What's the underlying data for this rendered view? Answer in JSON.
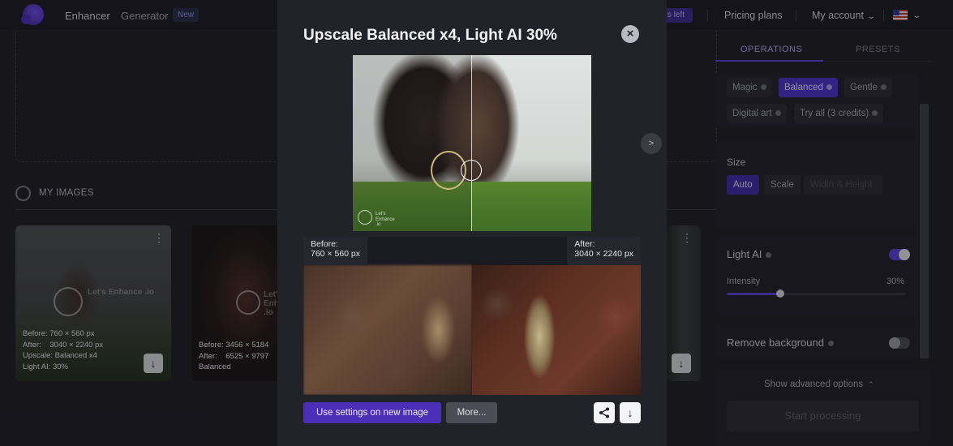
{
  "nav": {
    "enhancer": "Enhancer",
    "generator": "Generator",
    "new_badge": "New",
    "credits_left": "s left",
    "pricing": "Pricing plans",
    "account": "My account"
  },
  "gallery": {
    "section_label": "MY IMAGES",
    "thumb1": {
      "info": "Before: 760 × 560 px\nAfter:    3040 × 2240 px\nUpscale: Balanced x4\nLight AI: 30%",
      "watermark": "Let's\nEnhance\n.io"
    },
    "thumb2": {
      "info": "Before: 3456 × 5184\nAfter:    6525 × 9797\nBalanced",
      "watermark": "Let's\nEnhance\n.io"
    }
  },
  "panel": {
    "tab_operations": "OPERATIONS",
    "tab_presets": "PRESETS",
    "modes": [
      "Magic",
      "Balanced",
      "Gentle",
      "Digital art",
      "Try all (3 credits)"
    ],
    "active_mode": "Balanced",
    "size_label": "Size",
    "size_options": [
      "Auto",
      "Scale",
      "Width & Height"
    ],
    "active_size": "Auto",
    "light_ai_label": "Light AI",
    "light_ai_on": true,
    "intensity_label": "Intensity",
    "intensity_value": "30%",
    "intensity_fraction": 0.3,
    "remove_bg_label": "Remove background",
    "remove_bg_on": false,
    "advanced_label": "Show advanced options",
    "start_label": "Start processing"
  },
  "modal": {
    "title": "Upscale Balanced x4, Light AI 30%",
    "close_icon": "×",
    "next_icon": ">",
    "before_label": "Before:\n760 × 560 px",
    "after_label": "After:\n3040 × 2240 px",
    "watermark": "Let's\nEnhance\n.io",
    "use_settings_label": "Use settings on new image",
    "more_label": "More...",
    "accent_color": "#4c2fb8"
  }
}
